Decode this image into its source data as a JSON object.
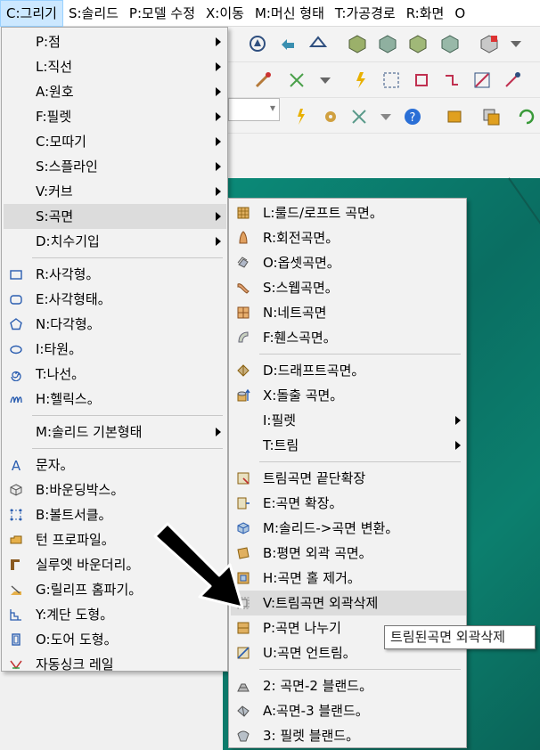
{
  "menubar": {
    "items": [
      "C:그리기",
      "S:솔리드",
      "P:모델 수정",
      "X:이동",
      "M:머신 형태",
      "T:가공경로",
      "R:화면",
      "O"
    ]
  },
  "main_menu": {
    "items": [
      {
        "label": "P:점",
        "submenu": true,
        "icon": ""
      },
      {
        "label": "L:직선",
        "submenu": true,
        "icon": ""
      },
      {
        "label": "A:원호",
        "submenu": true,
        "icon": ""
      },
      {
        "label": "F:필렛",
        "submenu": true,
        "icon": ""
      },
      {
        "label": "C:모따기",
        "submenu": true,
        "icon": ""
      },
      {
        "label": "S:스플라인",
        "submenu": true,
        "icon": ""
      },
      {
        "label": "V:커브",
        "submenu": true,
        "icon": ""
      },
      {
        "label": "S:곡면",
        "submenu": true,
        "icon": "",
        "highlighted": true
      },
      {
        "label": "D:치수기입",
        "submenu": true,
        "icon": ""
      },
      {
        "label": "R:사각형。",
        "submenu": false,
        "icon": "rectangle-icon"
      },
      {
        "label": "E:사각형태。",
        "submenu": false,
        "icon": "rounded-rectangle-icon"
      },
      {
        "label": "N:다각형。",
        "submenu": false,
        "icon": "polygon-icon"
      },
      {
        "label": "I:타원。",
        "submenu": false,
        "icon": "ellipse-icon"
      },
      {
        "label": "T:나선。",
        "submenu": false,
        "icon": "spiral-icon"
      },
      {
        "label": "H:헬릭스。",
        "submenu": false,
        "icon": "helix-icon"
      },
      {
        "label": "M:솔리드 기본형태",
        "submenu": true,
        "icon": ""
      },
      {
        "label": "문자。",
        "submenu": false,
        "icon": "letter-a-icon"
      },
      {
        "label": "B:바운딩박스。",
        "submenu": false,
        "icon": "bounding-box-icon"
      },
      {
        "label": "B:볼트서클。",
        "submenu": false,
        "icon": "bolt-circle-icon"
      },
      {
        "label": "턴 프로파일。",
        "submenu": false,
        "icon": "turn-profile-icon"
      },
      {
        "label": "실루엣 바운더리。",
        "submenu": false,
        "icon": "silhouette-icon"
      },
      {
        "label": "G:릴리프 홈파기。",
        "submenu": false,
        "icon": "relief-icon"
      },
      {
        "label": "Y:계단 도형。",
        "submenu": false,
        "icon": "stair-icon"
      },
      {
        "label": "O:도어 도형。",
        "submenu": false,
        "icon": "door-icon"
      },
      {
        "label": "자동싱크 레일",
        "submenu": false,
        "icon": "sink-rail-icon"
      }
    ]
  },
  "surface_menu": {
    "items": [
      {
        "label": "L:룰드/로프트 곡면。",
        "submenu": false,
        "icon": "ruled-surface-icon"
      },
      {
        "label": "R:회전곡면。",
        "submenu": false,
        "icon": "revolve-surface-icon"
      },
      {
        "label": "O:옵셋곡면。",
        "submenu": false,
        "icon": "offset-surface-icon"
      },
      {
        "label": "S:스웹곡면。",
        "submenu": false,
        "icon": "sweep-surface-icon"
      },
      {
        "label": "N:네트곡면",
        "submenu": false,
        "icon": "net-surface-icon"
      },
      {
        "label": "F:휀스곡면。",
        "submenu": false,
        "icon": "fence-surface-icon"
      },
      {
        "label": "D:드래프트곡면。",
        "submenu": false,
        "icon": "draft-surface-icon"
      },
      {
        "label": "X:돌출 곡면。",
        "submenu": false,
        "icon": "extrude-surface-icon"
      },
      {
        "label": "I:필렛",
        "submenu": true,
        "icon": ""
      },
      {
        "label": "T:트림",
        "submenu": true,
        "icon": ""
      },
      {
        "label": "트림곡면 끝단확장",
        "submenu": false,
        "icon": "extend-trimmed-icon"
      },
      {
        "label": "E:곡면 확장。",
        "submenu": false,
        "icon": "extend-surface-icon"
      },
      {
        "label": "M:솔리드->곡면 변환。",
        "submenu": false,
        "icon": "solid-to-surface-icon"
      },
      {
        "label": "B:평면 외곽 곡면。",
        "submenu": false,
        "icon": "flat-boundary-icon"
      },
      {
        "label": "H:곡면 홀 제거。",
        "submenu": false,
        "icon": "fill-holes-icon"
      },
      {
        "label": "V:트림곡면 외곽삭제",
        "submenu": false,
        "icon": "untrim-boundary-icon",
        "highlighted": true
      },
      {
        "label": "P:곡면 나누기",
        "submenu": false,
        "icon": "split-surface-icon"
      },
      {
        "label": "U:곡면 언트림。",
        "submenu": false,
        "icon": "untrim-icon"
      },
      {
        "label": "2: 곡면-2 블랜드。",
        "submenu": false,
        "icon": "blend-2-icon"
      },
      {
        "label": "A:곡면-3 블랜드。",
        "submenu": false,
        "icon": "blend-3-icon"
      },
      {
        "label": "3: 필렛 블랜드。",
        "submenu": false,
        "icon": "fillet-blend-icon"
      }
    ]
  },
  "tooltip": {
    "text": "트림된곡면 외곽삭제"
  },
  "colors": {
    "menu_bg": "#f2f2f2",
    "highlight": "#dcdcdc",
    "menubar_active": "#cce8ff",
    "viewport": "#0b7f6e"
  }
}
